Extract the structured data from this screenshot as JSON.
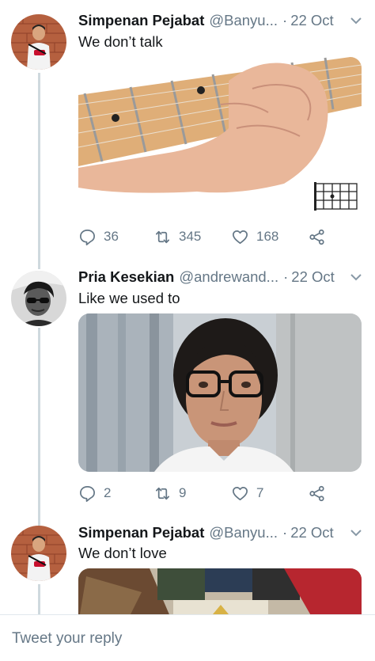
{
  "tweets": [
    {
      "name": "Simpenan Pejabat",
      "handle": "@Banyu...",
      "dot": "·",
      "date": "22 Oct",
      "text": "We don’t talk",
      "media_label": "guitar chord video",
      "stats": {
        "replies": "36",
        "retweets": "345",
        "likes": "168"
      }
    },
    {
      "name": "Pria Kesekian",
      "handle": "@andrewand...",
      "dot": "·",
      "date": "22 Oct",
      "text": "Like we used to",
      "media_label": "woman with glasses video",
      "stats": {
        "replies": "2",
        "retweets": "9",
        "likes": "7"
      }
    },
    {
      "name": "Simpenan Pejabat",
      "handle": "@Banyu...",
      "dot": "·",
      "date": "22 Oct",
      "text": "We don’t love",
      "media_label": "room scene video"
    }
  ],
  "reply": {
    "placeholder": "Tweet your reply"
  },
  "colors": {
    "text": "#14171a",
    "secondary": "#657786",
    "thread_line": "#cfd9de"
  },
  "icons": [
    "chevron-down-icon",
    "reply-icon",
    "retweet-icon",
    "like-icon",
    "share-icon"
  ]
}
